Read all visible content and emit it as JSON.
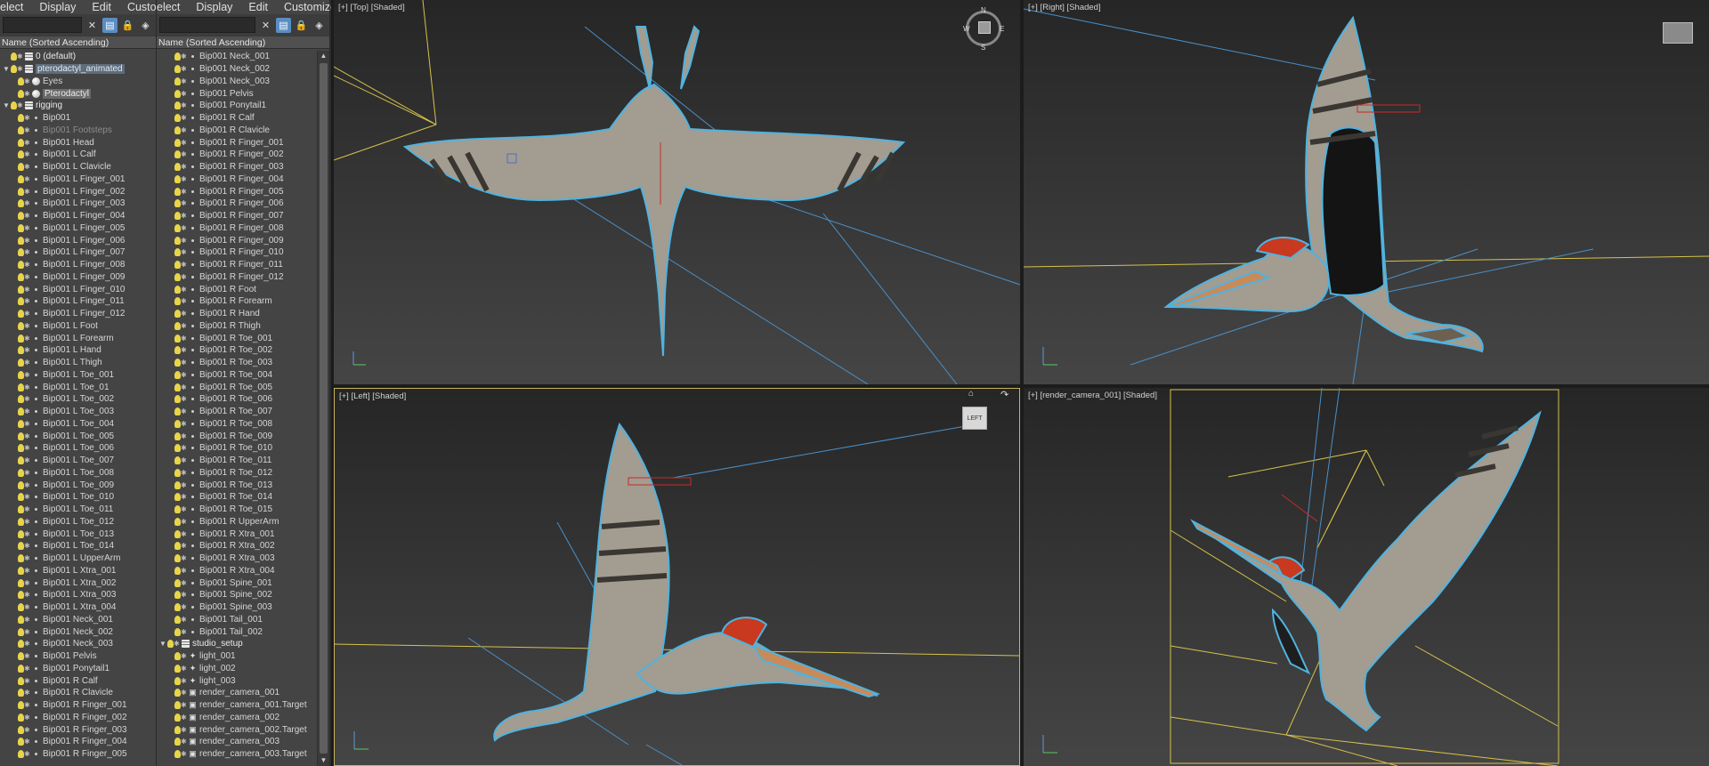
{
  "panel1": {
    "menu": [
      "elect",
      "Display",
      "Edit",
      "Customize"
    ],
    "column_header": "Name (Sorted Ascending)",
    "rows": [
      {
        "label": "0 (default)",
        "type": "layer",
        "indent": 0
      },
      {
        "label": "pterodactyl_animated",
        "type": "layer",
        "indent": 0,
        "state": "selected",
        "expanded": true
      },
      {
        "label": "Eyes",
        "type": "sphere",
        "indent": 1
      },
      {
        "label": "Pterodactyl",
        "type": "sphere",
        "indent": 1,
        "state": "highlight"
      },
      {
        "label": "rigging",
        "type": "layer",
        "indent": 0,
        "expanded": true
      },
      {
        "label": "Bip001",
        "type": "dot",
        "indent": 1
      },
      {
        "label": "Bip001 Footsteps",
        "type": "dot",
        "indent": 1,
        "state": "dim"
      },
      {
        "label": "Bip001 Head",
        "type": "dot",
        "indent": 1
      },
      {
        "label": "Bip001 L Calf",
        "type": "dot",
        "indent": 1
      },
      {
        "label": "Bip001 L Clavicle",
        "type": "dot",
        "indent": 1
      },
      {
        "label": "Bip001 L Finger_001",
        "type": "dot",
        "indent": 1
      },
      {
        "label": "Bip001 L Finger_002",
        "type": "dot",
        "indent": 1
      },
      {
        "label": "Bip001 L Finger_003",
        "type": "dot",
        "indent": 1
      },
      {
        "label": "Bip001 L Finger_004",
        "type": "dot",
        "indent": 1
      },
      {
        "label": "Bip001 L Finger_005",
        "type": "dot",
        "indent": 1
      },
      {
        "label": "Bip001 L Finger_006",
        "type": "dot",
        "indent": 1
      },
      {
        "label": "Bip001 L Finger_007",
        "type": "dot",
        "indent": 1
      },
      {
        "label": "Bip001 L Finger_008",
        "type": "dot",
        "indent": 1
      },
      {
        "label": "Bip001 L Finger_009",
        "type": "dot",
        "indent": 1
      },
      {
        "label": "Bip001 L Finger_010",
        "type": "dot",
        "indent": 1
      },
      {
        "label": "Bip001 L Finger_011",
        "type": "dot",
        "indent": 1
      },
      {
        "label": "Bip001 L Finger_012",
        "type": "dot",
        "indent": 1
      },
      {
        "label": "Bip001 L Foot",
        "type": "dot",
        "indent": 1
      },
      {
        "label": "Bip001 L Forearm",
        "type": "dot",
        "indent": 1
      },
      {
        "label": "Bip001 L Hand",
        "type": "dot",
        "indent": 1
      },
      {
        "label": "Bip001 L Thigh",
        "type": "dot",
        "indent": 1
      },
      {
        "label": "Bip001 L Toe_001",
        "type": "dot",
        "indent": 1
      },
      {
        "label": "Bip001 L Toe_01",
        "type": "dot",
        "indent": 1
      },
      {
        "label": "Bip001 L Toe_002",
        "type": "dot",
        "indent": 1
      },
      {
        "label": "Bip001 L Toe_003",
        "type": "dot",
        "indent": 1
      },
      {
        "label": "Bip001 L Toe_004",
        "type": "dot",
        "indent": 1
      },
      {
        "label": "Bip001 L Toe_005",
        "type": "dot",
        "indent": 1
      },
      {
        "label": "Bip001 L Toe_006",
        "type": "dot",
        "indent": 1
      },
      {
        "label": "Bip001 L Toe_007",
        "type": "dot",
        "indent": 1
      },
      {
        "label": "Bip001 L Toe_008",
        "type": "dot",
        "indent": 1
      },
      {
        "label": "Bip001 L Toe_009",
        "type": "dot",
        "indent": 1
      },
      {
        "label": "Bip001 L Toe_010",
        "type": "dot",
        "indent": 1
      },
      {
        "label": "Bip001 L Toe_011",
        "type": "dot",
        "indent": 1
      },
      {
        "label": "Bip001 L Toe_012",
        "type": "dot",
        "indent": 1
      },
      {
        "label": "Bip001 L Toe_013",
        "type": "dot",
        "indent": 1
      },
      {
        "label": "Bip001 L Toe_014",
        "type": "dot",
        "indent": 1
      },
      {
        "label": "Bip001 L UpperArm",
        "type": "dot",
        "indent": 1
      },
      {
        "label": "Bip001 L Xtra_001",
        "type": "dot",
        "indent": 1
      },
      {
        "label": "Bip001 L Xtra_002",
        "type": "dot",
        "indent": 1
      },
      {
        "label": "Bip001 L Xtra_003",
        "type": "dot",
        "indent": 1
      },
      {
        "label": "Bip001 L Xtra_004",
        "type": "dot",
        "indent": 1
      },
      {
        "label": "Bip001 Neck_001",
        "type": "dot",
        "indent": 1
      },
      {
        "label": "Bip001 Neck_002",
        "type": "dot",
        "indent": 1
      },
      {
        "label": "Bip001 Neck_003",
        "type": "dot",
        "indent": 1
      },
      {
        "label": "Bip001 Pelvis",
        "type": "dot",
        "indent": 1
      },
      {
        "label": "Bip001 Ponytail1",
        "type": "dot",
        "indent": 1
      },
      {
        "label": "Bip001 R Calf",
        "type": "dot",
        "indent": 1
      },
      {
        "label": "Bip001 R Clavicle",
        "type": "dot",
        "indent": 1
      },
      {
        "label": "Bip001 R Finger_001",
        "type": "dot",
        "indent": 1
      },
      {
        "label": "Bip001 R Finger_002",
        "type": "dot",
        "indent": 1
      },
      {
        "label": "Bip001 R Finger_003",
        "type": "dot",
        "indent": 1
      },
      {
        "label": "Bip001 R Finger_004",
        "type": "dot",
        "indent": 1
      },
      {
        "label": "Bip001 R Finger_005",
        "type": "dot",
        "indent": 1
      }
    ]
  },
  "panel2": {
    "menu": [
      "elect",
      "Display",
      "Edit",
      "Customize"
    ],
    "column_header": "Name (Sorted Ascending)",
    "rows": [
      {
        "label": "Bip001 Neck_001",
        "type": "dot",
        "indent": 1
      },
      {
        "label": "Bip001 Neck_002",
        "type": "dot",
        "indent": 1
      },
      {
        "label": "Bip001 Neck_003",
        "type": "dot",
        "indent": 1
      },
      {
        "label": "Bip001 Pelvis",
        "type": "dot",
        "indent": 1
      },
      {
        "label": "Bip001 Ponytail1",
        "type": "dot",
        "indent": 1
      },
      {
        "label": "Bip001 R Calf",
        "type": "dot",
        "indent": 1
      },
      {
        "label": "Bip001 R Clavicle",
        "type": "dot",
        "indent": 1
      },
      {
        "label": "Bip001 R Finger_001",
        "type": "dot",
        "indent": 1
      },
      {
        "label": "Bip001 R Finger_002",
        "type": "dot",
        "indent": 1
      },
      {
        "label": "Bip001 R Finger_003",
        "type": "dot",
        "indent": 1
      },
      {
        "label": "Bip001 R Finger_004",
        "type": "dot",
        "indent": 1
      },
      {
        "label": "Bip001 R Finger_005",
        "type": "dot",
        "indent": 1
      },
      {
        "label": "Bip001 R Finger_006",
        "type": "dot",
        "indent": 1
      },
      {
        "label": "Bip001 R Finger_007",
        "type": "dot",
        "indent": 1
      },
      {
        "label": "Bip001 R Finger_008",
        "type": "dot",
        "indent": 1
      },
      {
        "label": "Bip001 R Finger_009",
        "type": "dot",
        "indent": 1
      },
      {
        "label": "Bip001 R Finger_010",
        "type": "dot",
        "indent": 1
      },
      {
        "label": "Bip001 R Finger_011",
        "type": "dot",
        "indent": 1
      },
      {
        "label": "Bip001 R Finger_012",
        "type": "dot",
        "indent": 1
      },
      {
        "label": "Bip001 R Foot",
        "type": "dot",
        "indent": 1
      },
      {
        "label": "Bip001 R Forearm",
        "type": "dot",
        "indent": 1
      },
      {
        "label": "Bip001 R Hand",
        "type": "dot",
        "indent": 1
      },
      {
        "label": "Bip001 R Thigh",
        "type": "dot",
        "indent": 1
      },
      {
        "label": "Bip001 R Toe_001",
        "type": "dot",
        "indent": 1
      },
      {
        "label": "Bip001 R Toe_002",
        "type": "dot",
        "indent": 1
      },
      {
        "label": "Bip001 R Toe_003",
        "type": "dot",
        "indent": 1
      },
      {
        "label": "Bip001 R Toe_004",
        "type": "dot",
        "indent": 1
      },
      {
        "label": "Bip001 R Toe_005",
        "type": "dot",
        "indent": 1
      },
      {
        "label": "Bip001 R Toe_006",
        "type": "dot",
        "indent": 1
      },
      {
        "label": "Bip001 R Toe_007",
        "type": "dot",
        "indent": 1
      },
      {
        "label": "Bip001 R Toe_008",
        "type": "dot",
        "indent": 1
      },
      {
        "label": "Bip001 R Toe_009",
        "type": "dot",
        "indent": 1
      },
      {
        "label": "Bip001 R Toe_010",
        "type": "dot",
        "indent": 1
      },
      {
        "label": "Bip001 R Toe_011",
        "type": "dot",
        "indent": 1
      },
      {
        "label": "Bip001 R Toe_012",
        "type": "dot",
        "indent": 1
      },
      {
        "label": "Bip001 R Toe_013",
        "type": "dot",
        "indent": 1
      },
      {
        "label": "Bip001 R Toe_014",
        "type": "dot",
        "indent": 1
      },
      {
        "label": "Bip001 R Toe_015",
        "type": "dot",
        "indent": 1
      },
      {
        "label": "Bip001 R UpperArm",
        "type": "dot",
        "indent": 1
      },
      {
        "label": "Bip001 R Xtra_001",
        "type": "dot",
        "indent": 1
      },
      {
        "label": "Bip001 R Xtra_002",
        "type": "dot",
        "indent": 1
      },
      {
        "label": "Bip001 R Xtra_003",
        "type": "dot",
        "indent": 1
      },
      {
        "label": "Bip001 R Xtra_004",
        "type": "dot",
        "indent": 1
      },
      {
        "label": "Bip001 Spine_001",
        "type": "dot",
        "indent": 1
      },
      {
        "label": "Bip001 Spine_002",
        "type": "dot",
        "indent": 1
      },
      {
        "label": "Bip001 Spine_003",
        "type": "dot",
        "indent": 1
      },
      {
        "label": "Bip001 Tail_001",
        "type": "dot",
        "indent": 1
      },
      {
        "label": "Bip001 Tail_002",
        "type": "dot",
        "indent": 1
      },
      {
        "label": "studio_setup",
        "type": "layer",
        "indent": 0,
        "expanded": true
      },
      {
        "label": "light_001",
        "type": "light",
        "indent": 1
      },
      {
        "label": "light_002",
        "type": "light",
        "indent": 1
      },
      {
        "label": "light_003",
        "type": "light",
        "indent": 1
      },
      {
        "label": "render_camera_001",
        "type": "cam",
        "indent": 1
      },
      {
        "label": "render_camera_001.Target",
        "type": "cam",
        "indent": 1
      },
      {
        "label": "render_camera_002",
        "type": "cam",
        "indent": 1
      },
      {
        "label": "render_camera_002.Target",
        "type": "cam",
        "indent": 1
      },
      {
        "label": "render_camera_003",
        "type": "cam",
        "indent": 1
      },
      {
        "label": "render_camera_003.Target",
        "type": "cam",
        "indent": 1
      }
    ]
  },
  "viewports": {
    "top": {
      "label": "[+] [Top] [Shaded]"
    },
    "right": {
      "label": "[+] [Right] [Shaded]"
    },
    "left": {
      "label": "[+] [Left] [Shaded]",
      "viewcube_face": "LEFT"
    },
    "camera": {
      "label": "[+] [render_camera_001] [Shaded]"
    }
  },
  "viewcube": {
    "compass_n": "N",
    "compass_s": "S",
    "compass_w": "W",
    "compass_e": "E"
  },
  "colors": {
    "accent": "#5a8dc2",
    "skin": "#a39c90",
    "outline": "#4fb3e0",
    "crest": "#c8391f",
    "guide_line": "#d6c24a",
    "light_line": "#4a90c8",
    "active_border": "#c8b45a"
  }
}
